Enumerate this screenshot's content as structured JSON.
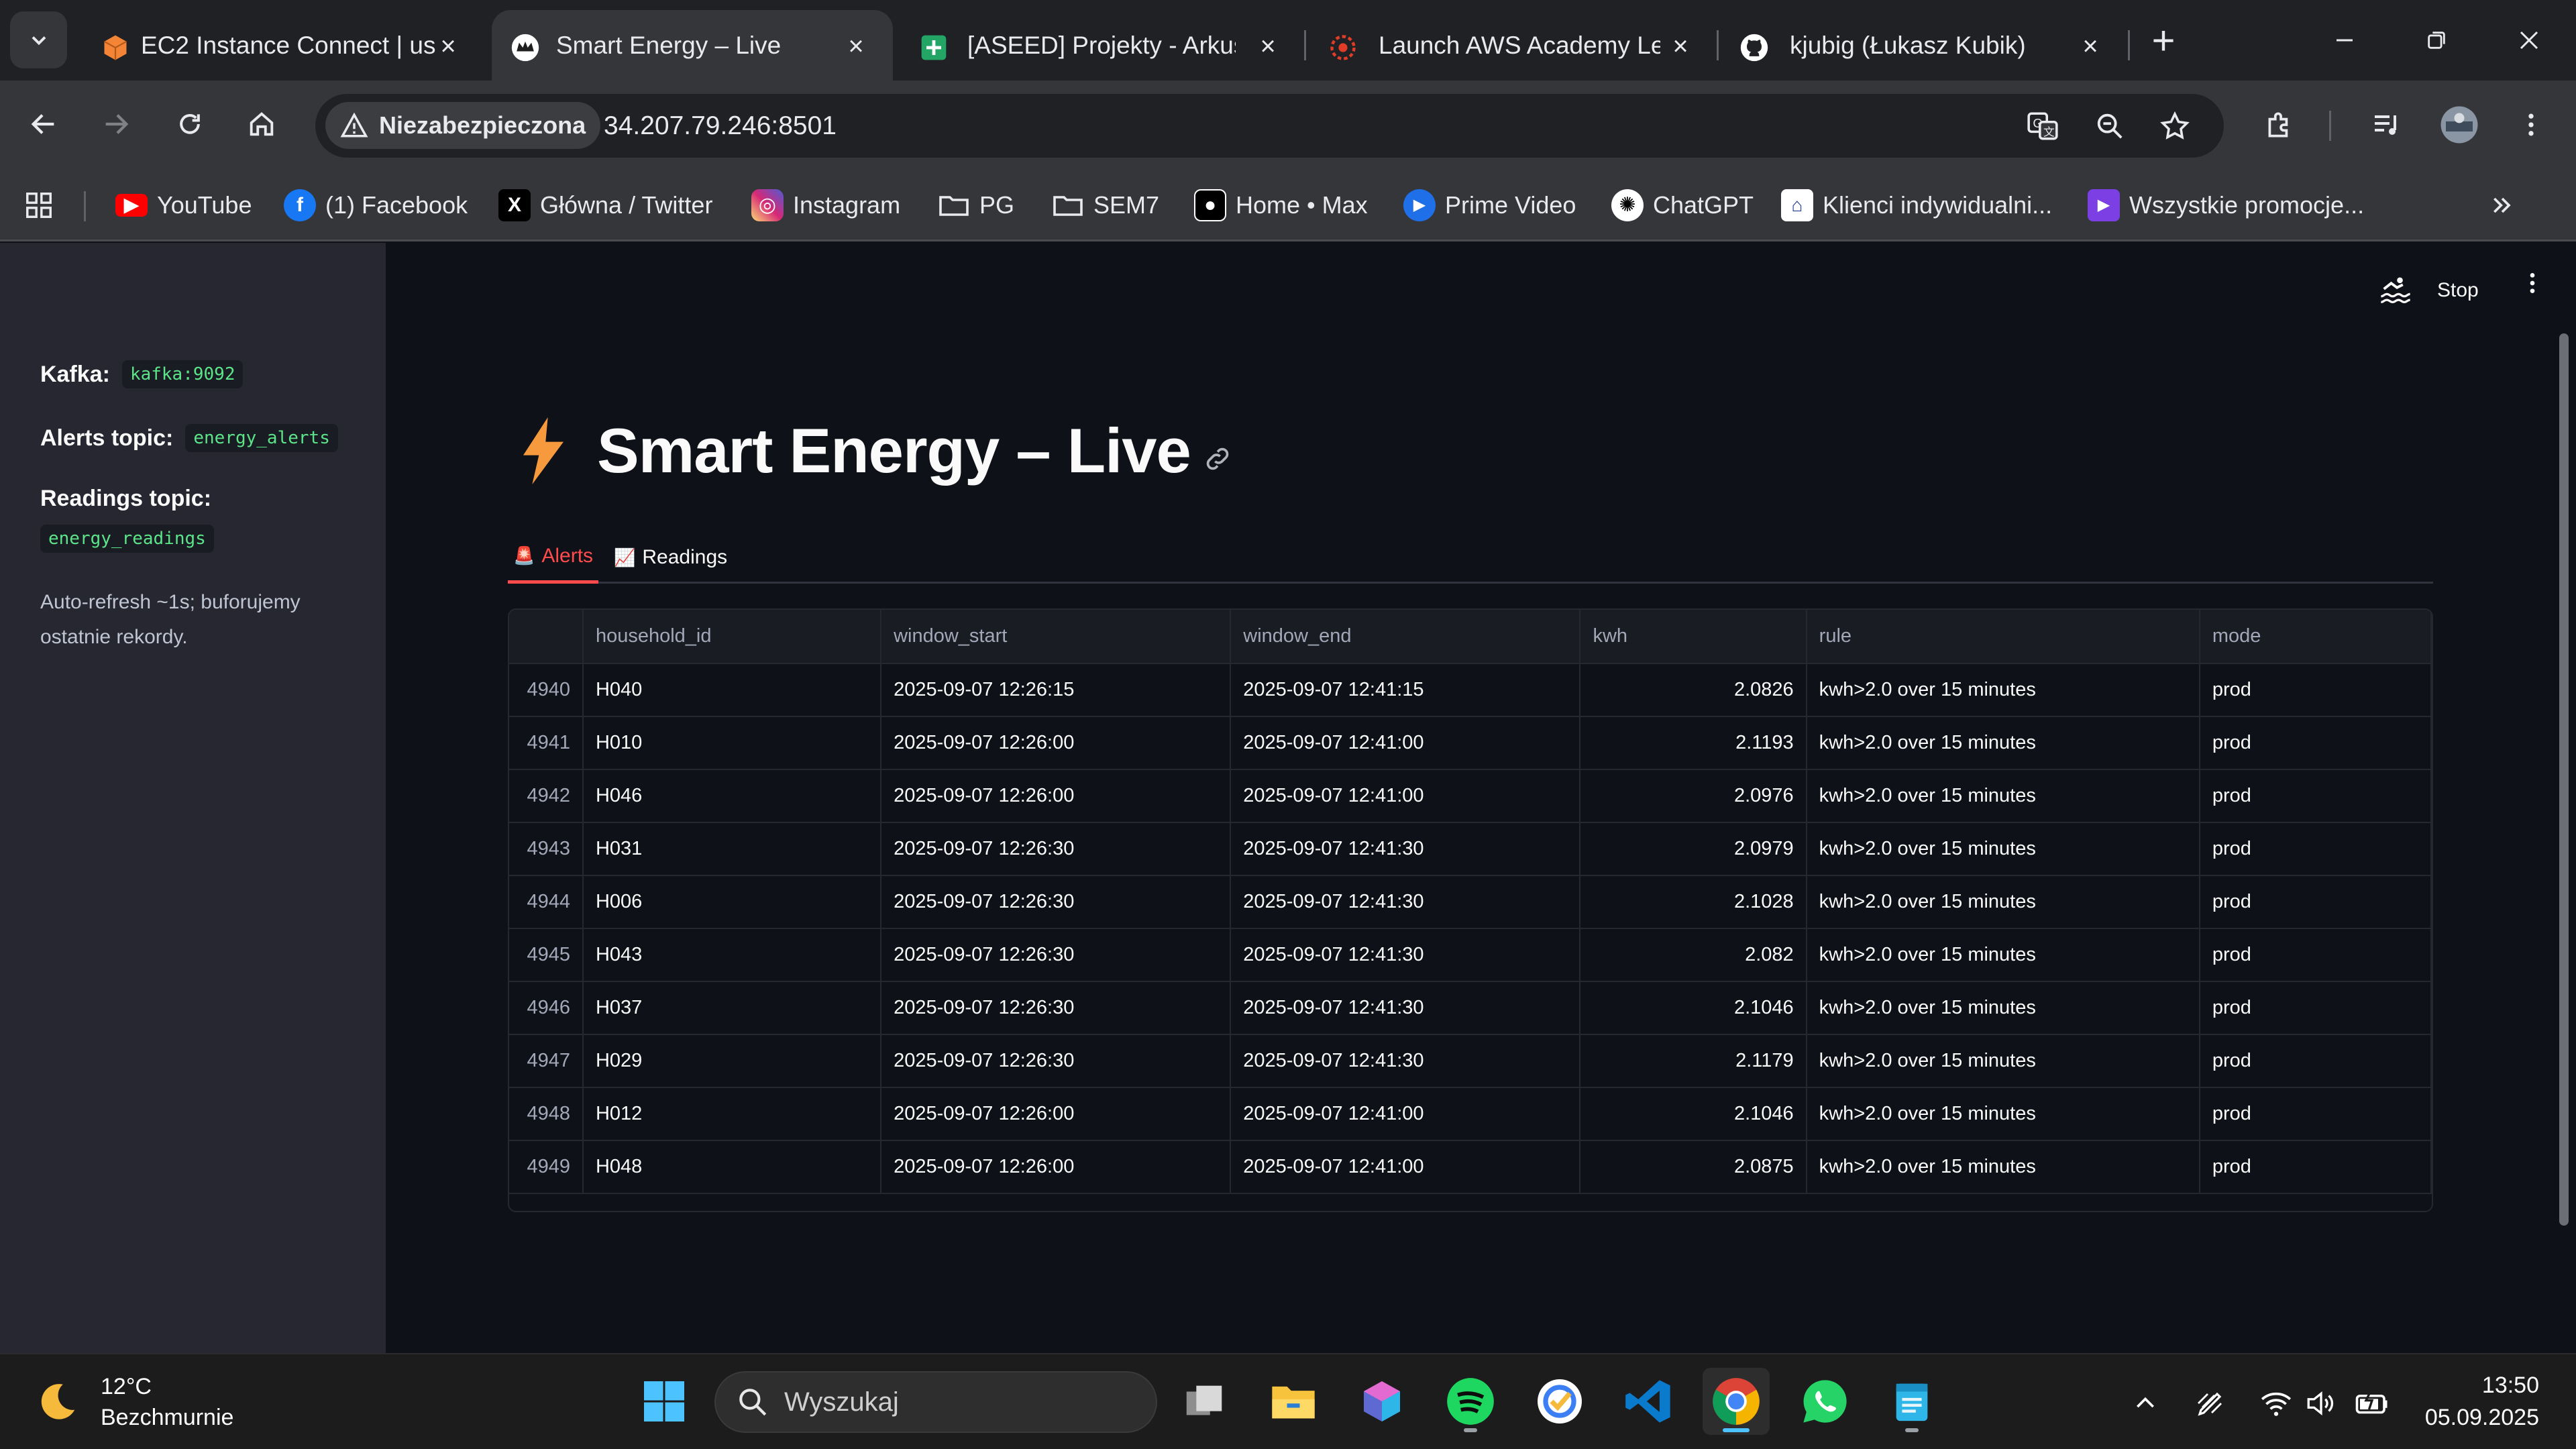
{
  "browser": {
    "tabs": [
      {
        "title": "EC2 Instance Connect | us",
        "icon": "aws-box-icon",
        "active": false
      },
      {
        "title": "Smart Energy – Live",
        "icon": "streamlit-crown-icon",
        "active": true
      },
      {
        "title": "[ASEED] Projekty - Arkusz",
        "icon": "sheets-icon",
        "active": false
      },
      {
        "title": "Launch AWS Academy Le",
        "icon": "canvas-icon",
        "active": false
      },
      {
        "title": "kjubig (Łukasz Kubik)",
        "icon": "github-icon",
        "active": false
      }
    ],
    "security_label": "Niezabezpieczona",
    "url": "34.207.79.246:8501",
    "bookmarks": [
      {
        "label": "YouTube",
        "icon": "youtube-icon",
        "color": "#ff0000"
      },
      {
        "label": "(1) Facebook",
        "icon": "facebook-icon",
        "color": "#1877f2"
      },
      {
        "label": "Główna / Twitter",
        "icon": "x-icon",
        "color": "#000000"
      },
      {
        "label": "Instagram",
        "icon": "instagram-icon",
        "color": "#d62976"
      },
      {
        "label": "PG",
        "icon": "folder-icon"
      },
      {
        "label": "SEM7",
        "icon": "folder-icon"
      },
      {
        "label": "Home • Max",
        "icon": "max-icon",
        "color": "#000000"
      },
      {
        "label": "Prime Video",
        "icon": "prime-video-icon",
        "color": "#1f6fe8"
      },
      {
        "label": "ChatGPT",
        "icon": "chatgpt-icon",
        "color": "#ffffff"
      },
      {
        "label": "Klienci indywidualni...",
        "icon": "bank-icon",
        "color": "#ffffff"
      },
      {
        "label": "Wszystkie promocje...",
        "icon": "promo-icon",
        "color": "#7b3fe4"
      }
    ]
  },
  "sidebar": {
    "kafka_label": "Kafka:",
    "kafka_value": "kafka:9092",
    "alerts_topic_label": "Alerts topic:",
    "alerts_topic_value": "energy_alerts",
    "readings_topic_label": "Readings topic:",
    "readings_topic_value": "energy_readings",
    "note": "Auto-refresh ~1s; buforujemy ostatnie rekordy."
  },
  "app": {
    "stop_label": "Stop",
    "title": "Smart Energy – Live",
    "tabs": [
      {
        "label": "Alerts",
        "icon": "alarm-light-icon",
        "emoji": "🚨",
        "active": true
      },
      {
        "label": "Readings",
        "icon": "chart-icon",
        "emoji": "📈",
        "active": false
      }
    ],
    "table": {
      "columns": [
        "",
        "household_id",
        "window_start",
        "window_end",
        "kwh",
        "rule",
        "mode"
      ],
      "rows": [
        [
          "4940",
          "H040",
          "2025-09-07 12:26:15",
          "2025-09-07 12:41:15",
          "2.0826",
          "kwh>2.0 over 15 minutes",
          "prod"
        ],
        [
          "4941",
          "H010",
          "2025-09-07 12:26:00",
          "2025-09-07 12:41:00",
          "2.1193",
          "kwh>2.0 over 15 minutes",
          "prod"
        ],
        [
          "4942",
          "H046",
          "2025-09-07 12:26:00",
          "2025-09-07 12:41:00",
          "2.0976",
          "kwh>2.0 over 15 minutes",
          "prod"
        ],
        [
          "4943",
          "H031",
          "2025-09-07 12:26:30",
          "2025-09-07 12:41:30",
          "2.0979",
          "kwh>2.0 over 15 minutes",
          "prod"
        ],
        [
          "4944",
          "H006",
          "2025-09-07 12:26:30",
          "2025-09-07 12:41:30",
          "2.1028",
          "kwh>2.0 over 15 minutes",
          "prod"
        ],
        [
          "4945",
          "H043",
          "2025-09-07 12:26:30",
          "2025-09-07 12:41:30",
          "2.082",
          "kwh>2.0 over 15 minutes",
          "prod"
        ],
        [
          "4946",
          "H037",
          "2025-09-07 12:26:30",
          "2025-09-07 12:41:30",
          "2.1046",
          "kwh>2.0 over 15 minutes",
          "prod"
        ],
        [
          "4947",
          "H029",
          "2025-09-07 12:26:30",
          "2025-09-07 12:41:30",
          "2.1179",
          "kwh>2.0 over 15 minutes",
          "prod"
        ],
        [
          "4948",
          "H012",
          "2025-09-07 12:26:00",
          "2025-09-07 12:41:00",
          "2.1046",
          "kwh>2.0 over 15 minutes",
          "prod"
        ],
        [
          "4949",
          "H048",
          "2025-09-07 12:26:00",
          "2025-09-07 12:41:00",
          "2.0875",
          "kwh>2.0 over 15 minutes",
          "prod"
        ]
      ]
    }
  },
  "taskbar": {
    "temperature": "12°C",
    "weather": "Bezchmurnie",
    "search_placeholder": "Wyszukaj",
    "time": "13:50",
    "date": "05.09.2025"
  }
}
